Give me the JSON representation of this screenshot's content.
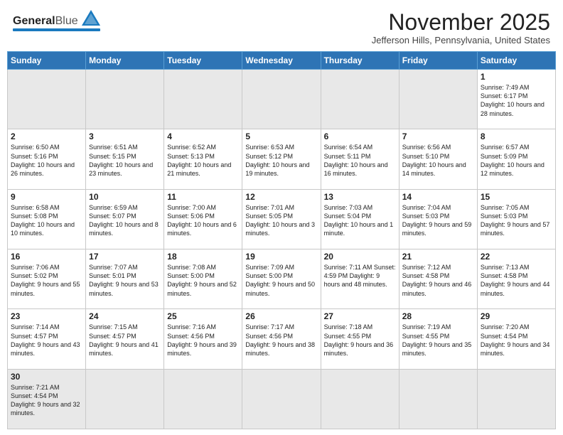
{
  "header": {
    "logo_general": "General",
    "logo_blue": "Blue",
    "month_title": "November 2025",
    "subtitle": "Jefferson Hills, Pennsylvania, United States"
  },
  "days_of_week": [
    "Sunday",
    "Monday",
    "Tuesday",
    "Wednesday",
    "Thursday",
    "Friday",
    "Saturday"
  ],
  "weeks": [
    [
      {
        "day": "",
        "info": "",
        "empty": true
      },
      {
        "day": "",
        "info": "",
        "empty": true
      },
      {
        "day": "",
        "info": "",
        "empty": true
      },
      {
        "day": "",
        "info": "",
        "empty": true
      },
      {
        "day": "",
        "info": "",
        "empty": true
      },
      {
        "day": "",
        "info": "",
        "empty": true
      },
      {
        "day": "1",
        "info": "Sunrise: 7:49 AM\nSunset: 6:17 PM\nDaylight: 10 hours and 28 minutes.",
        "empty": false
      }
    ],
    [
      {
        "day": "2",
        "info": "Sunrise: 6:50 AM\nSunset: 5:16 PM\nDaylight: 10 hours and 26 minutes.",
        "empty": false
      },
      {
        "day": "3",
        "info": "Sunrise: 6:51 AM\nSunset: 5:15 PM\nDaylight: 10 hours and 23 minutes.",
        "empty": false
      },
      {
        "day": "4",
        "info": "Sunrise: 6:52 AM\nSunset: 5:13 PM\nDaylight: 10 hours and 21 minutes.",
        "empty": false
      },
      {
        "day": "5",
        "info": "Sunrise: 6:53 AM\nSunset: 5:12 PM\nDaylight: 10 hours and 19 minutes.",
        "empty": false
      },
      {
        "day": "6",
        "info": "Sunrise: 6:54 AM\nSunset: 5:11 PM\nDaylight: 10 hours and 16 minutes.",
        "empty": false
      },
      {
        "day": "7",
        "info": "Sunrise: 6:56 AM\nSunset: 5:10 PM\nDaylight: 10 hours and 14 minutes.",
        "empty": false
      },
      {
        "day": "8",
        "info": "Sunrise: 6:57 AM\nSunset: 5:09 PM\nDaylight: 10 hours and 12 minutes.",
        "empty": false
      }
    ],
    [
      {
        "day": "9",
        "info": "Sunrise: 6:58 AM\nSunset: 5:08 PM\nDaylight: 10 hours and 10 minutes.",
        "empty": false
      },
      {
        "day": "10",
        "info": "Sunrise: 6:59 AM\nSunset: 5:07 PM\nDaylight: 10 hours and 8 minutes.",
        "empty": false
      },
      {
        "day": "11",
        "info": "Sunrise: 7:00 AM\nSunset: 5:06 PM\nDaylight: 10 hours and 6 minutes.",
        "empty": false
      },
      {
        "day": "12",
        "info": "Sunrise: 7:01 AM\nSunset: 5:05 PM\nDaylight: 10 hours and 3 minutes.",
        "empty": false
      },
      {
        "day": "13",
        "info": "Sunrise: 7:03 AM\nSunset: 5:04 PM\nDaylight: 10 hours and 1 minute.",
        "empty": false
      },
      {
        "day": "14",
        "info": "Sunrise: 7:04 AM\nSunset: 5:03 PM\nDaylight: 9 hours and 59 minutes.",
        "empty": false
      },
      {
        "day": "15",
        "info": "Sunrise: 7:05 AM\nSunset: 5:03 PM\nDaylight: 9 hours and 57 minutes.",
        "empty": false
      }
    ],
    [
      {
        "day": "16",
        "info": "Sunrise: 7:06 AM\nSunset: 5:02 PM\nDaylight: 9 hours and 55 minutes.",
        "empty": false
      },
      {
        "day": "17",
        "info": "Sunrise: 7:07 AM\nSunset: 5:01 PM\nDaylight: 9 hours and 53 minutes.",
        "empty": false
      },
      {
        "day": "18",
        "info": "Sunrise: 7:08 AM\nSunset: 5:00 PM\nDaylight: 9 hours and 52 minutes.",
        "empty": false
      },
      {
        "day": "19",
        "info": "Sunrise: 7:09 AM\nSunset: 5:00 PM\nDaylight: 9 hours and 50 minutes.",
        "empty": false
      },
      {
        "day": "20",
        "info": "Sunrise: 7:11 AM\nSunset: 4:59 PM\nDaylight: 9 hours and 48 minutes.",
        "empty": false
      },
      {
        "day": "21",
        "info": "Sunrise: 7:12 AM\nSunset: 4:58 PM\nDaylight: 9 hours and 46 minutes.",
        "empty": false
      },
      {
        "day": "22",
        "info": "Sunrise: 7:13 AM\nSunset: 4:58 PM\nDaylight: 9 hours and 44 minutes.",
        "empty": false
      }
    ],
    [
      {
        "day": "23",
        "info": "Sunrise: 7:14 AM\nSunset: 4:57 PM\nDaylight: 9 hours and 43 minutes.",
        "empty": false
      },
      {
        "day": "24",
        "info": "Sunrise: 7:15 AM\nSunset: 4:57 PM\nDaylight: 9 hours and 41 minutes.",
        "empty": false
      },
      {
        "day": "25",
        "info": "Sunrise: 7:16 AM\nSunset: 4:56 PM\nDaylight: 9 hours and 39 minutes.",
        "empty": false
      },
      {
        "day": "26",
        "info": "Sunrise: 7:17 AM\nSunset: 4:56 PM\nDaylight: 9 hours and 38 minutes.",
        "empty": false
      },
      {
        "day": "27",
        "info": "Sunrise: 7:18 AM\nSunset: 4:55 PM\nDaylight: 9 hours and 36 minutes.",
        "empty": false
      },
      {
        "day": "28",
        "info": "Sunrise: 7:19 AM\nSunset: 4:55 PM\nDaylight: 9 hours and 35 minutes.",
        "empty": false
      },
      {
        "day": "29",
        "info": "Sunrise: 7:20 AM\nSunset: 4:54 PM\nDaylight: 9 hours and 34 minutes.",
        "empty": false
      }
    ],
    [
      {
        "day": "30",
        "info": "Sunrise: 7:21 AM\nSunset: 4:54 PM\nDaylight: 9 hours and 32 minutes.",
        "empty": false
      },
      {
        "day": "",
        "info": "",
        "empty": true
      },
      {
        "day": "",
        "info": "",
        "empty": true
      },
      {
        "day": "",
        "info": "",
        "empty": true
      },
      {
        "day": "",
        "info": "",
        "empty": true
      },
      {
        "day": "",
        "info": "",
        "empty": true
      },
      {
        "day": "",
        "info": "",
        "empty": true
      }
    ]
  ]
}
